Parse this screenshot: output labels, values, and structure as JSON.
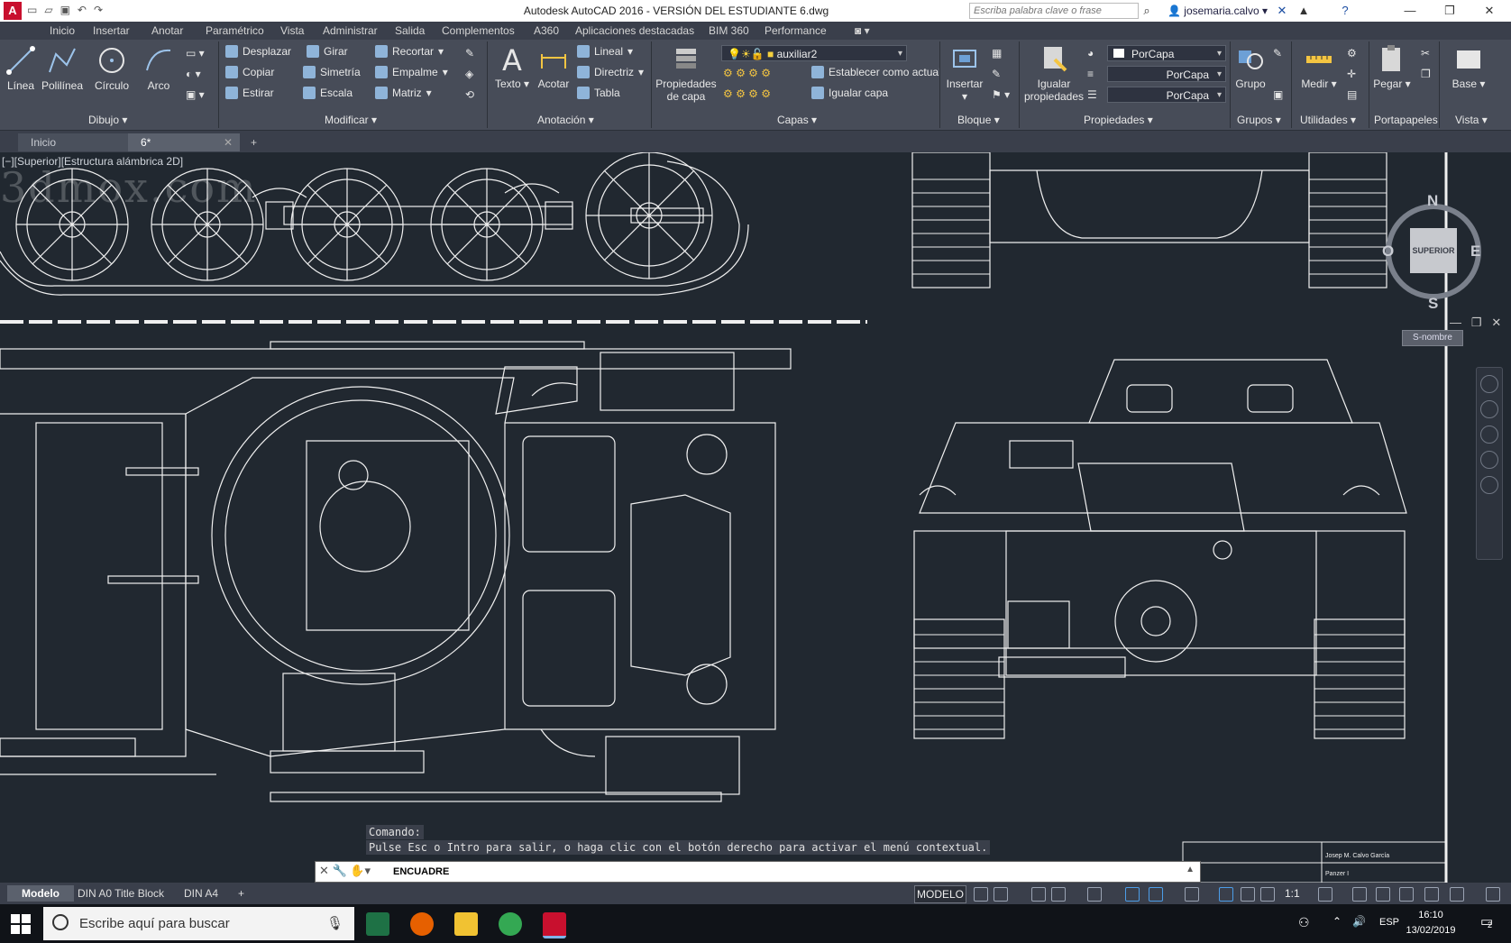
{
  "titlebar": {
    "app_title": "Autodesk AutoCAD 2016 - VERSIÓN DEL ESTUDIANTE    6.dwg",
    "search_placeholder": "Escriba palabra clave o frase",
    "user": "josemaria.calvo",
    "app_icon": "A"
  },
  "menu_tabs": [
    "Inicio",
    "Insertar",
    "Anotar",
    "Paramétrico",
    "Vista",
    "Administrar",
    "Salida",
    "Complementos",
    "A360",
    "Aplicaciones destacadas",
    "BIM 360",
    "Performance"
  ],
  "ribbon": {
    "dibujo": {
      "linea": "Línea",
      "polilinea": "Polilínea",
      "circulo": "Círculo",
      "arco": "Arco",
      "panel": "Dibujo"
    },
    "modificar": {
      "desplazar": "Desplazar",
      "girar": "Girar",
      "recortar": "Recortar",
      "copiar": "Copiar",
      "simetria": "Simetría",
      "empalme": "Empalme",
      "estirar": "Estirar",
      "escala": "Escala",
      "matriz": "Matriz",
      "panel": "Modificar"
    },
    "anotacion": {
      "texto": "Texto",
      "acotar": "Acotar",
      "lineal": "Lineal",
      "directriz": "Directriz",
      "tabla": "Tabla",
      "panel": "Anotación"
    },
    "capas": {
      "propiedades": "Propiedades de capa",
      "layer_name": "auxiliar2",
      "establecer": "Establecer como actual",
      "igualar": "Igualar capa",
      "panel": "Capas"
    },
    "bloque": {
      "insertar": "Insertar",
      "panel": "Bloque"
    },
    "propiedades": {
      "igualar": "Igualar propiedades",
      "color": "PorCapa",
      "linetype": "PorCapa",
      "lineweight": "PorCapa",
      "panel": "Propiedades"
    },
    "grupos": {
      "grupo": "Grupo",
      "panel": "Grupos"
    },
    "utilidades": {
      "medir": "Medir",
      "panel": "Utilidades"
    },
    "portapapeles": {
      "pegar": "Pegar",
      "panel": "Portapapeles"
    },
    "vista": {
      "base": "Base",
      "panel": "Vista"
    }
  },
  "doc_tabs": {
    "inicio": "Inicio",
    "current": "6*",
    "add": "+"
  },
  "viewport": {
    "label": "[−][Superior][Estructura alámbrica 2D]"
  },
  "viewcube": {
    "n": "N",
    "s": "S",
    "e": "E",
    "w": "O",
    "face": "SUPERIOR",
    "ucs": "S-nombre"
  },
  "title_block": {
    "author": "Josep M. Calvo García",
    "title": "Panzer I"
  },
  "command": {
    "history_label": "Comando:",
    "history_text": "Pulse Esc o Intro para salir, o haga clic con el botón derecho para activar el menú contextual.",
    "current": "ENCUADRE"
  },
  "layout_tabs": [
    "Modelo",
    "DIN A0 Title Block",
    "DIN A4",
    "+"
  ],
  "status": {
    "mode": "MODELO",
    "scale": "1:1"
  },
  "taskbar": {
    "search": "Escribe aquí para buscar",
    "lang": "ESP",
    "time": "16:10",
    "date": "13/02/2019",
    "notifications": "2"
  },
  "watermark": "3dmox.com",
  "colors": {
    "drawing_bg": "#212830",
    "line": "#f2f2f2",
    "ribbon": "#474c58",
    "autocad_red": "#c8102e"
  }
}
